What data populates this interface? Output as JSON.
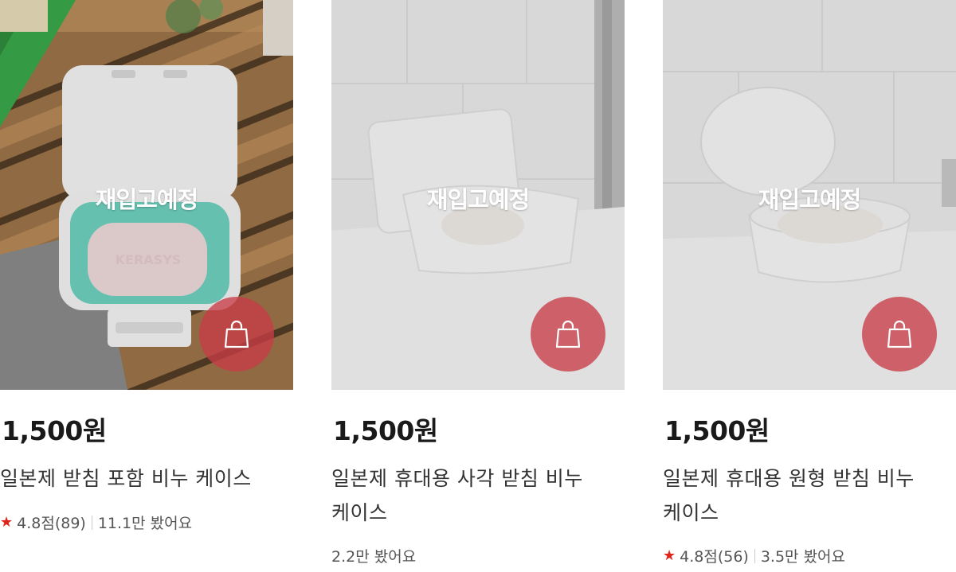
{
  "colors": {
    "cart_button": "#c83c46",
    "star": "#e2231a",
    "price_text": "#1a1a1a"
  },
  "products": [
    {
      "overlay_label": "재입고예정",
      "price": "1,500원",
      "title": "일본제 받침 포함 비누 케이스",
      "rating": "4.8점(89)",
      "views": "11.1만 봤어요",
      "cart_icon": "shopping-bag-icon"
    },
    {
      "overlay_label": "재입고예정",
      "price": "1,500원",
      "title": "일본제 휴대용 사각 받침 비누 케이스",
      "views": "2.2만 봤어요",
      "cart_icon": "shopping-bag-icon"
    },
    {
      "overlay_label": "재입고예정",
      "price": "1,500원",
      "title": "일본제 휴대용 원형 받침 비누 케이스",
      "rating": "4.8점(56)",
      "views": "3.5만 봤어요",
      "cart_icon": "shopping-bag-icon"
    }
  ]
}
